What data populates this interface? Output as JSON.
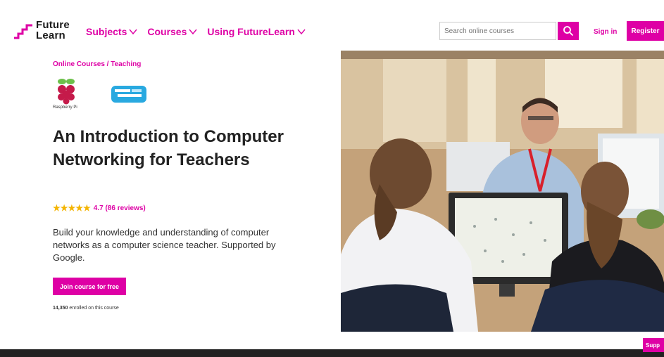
{
  "brand": {
    "line1": "Future",
    "line2": "Learn",
    "color": "#de00a5"
  },
  "nav": {
    "items": [
      {
        "label": "Subjects"
      },
      {
        "label": "Courses"
      },
      {
        "label": "Using FutureLearn"
      }
    ]
  },
  "search": {
    "placeholder": "Search online courses"
  },
  "header": {
    "signin": "Sign in",
    "register": "Register"
  },
  "breadcrumb": "Online Courses / Teaching",
  "partners": {
    "rpi_label": "Raspberry Pi"
  },
  "course": {
    "title": "An Introduction to Computer Networking for Teachers",
    "rating_stars": "★★★★★",
    "rating": "4.7 (86 reviews)",
    "rating_value": 4.7,
    "description": "Build your knowledge and understanding of computer networks as a computer science teacher. Supported by Google.",
    "join_label": "Join course for free",
    "enrolled_count": "14,350",
    "enrolled_suffix": " enrolled on this course"
  },
  "support_label": "Supp"
}
